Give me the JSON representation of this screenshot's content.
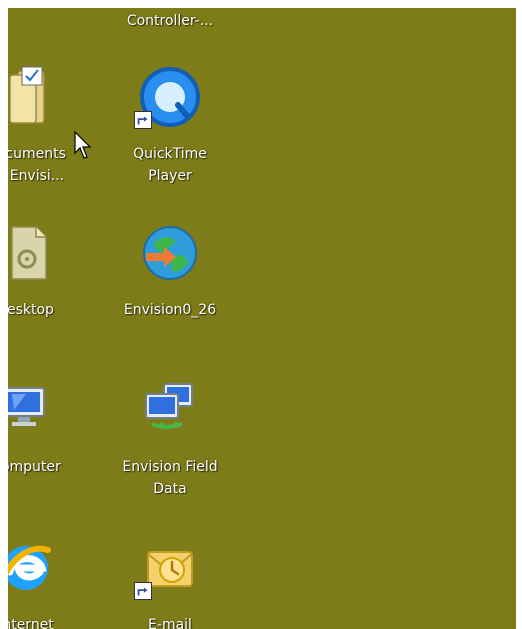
{
  "desktop": {
    "background_color": "#7e7c18",
    "icons": [
      {
        "label": "Controller-...",
        "icon": "controller-icon"
      },
      {
        "label_line1": "Documents",
        "label_line2": "on Envisi...",
        "icon": "folder-documents-icon"
      },
      {
        "label_line1": "QuickTime",
        "label_line2": "Player",
        "icon": "quicktime-icon"
      },
      {
        "label": "desktop",
        "icon": "desktop-file-icon"
      },
      {
        "label": "Envision0_26",
        "icon": "globe-icon"
      },
      {
        "label": "Computer",
        "icon": "computer-icon"
      },
      {
        "label_line1": "Envision Field",
        "label_line2": "Data",
        "icon": "network-icon"
      },
      {
        "label": "Internet",
        "icon": "internet-explorer-icon"
      },
      {
        "label": "E-mail",
        "icon": "email-icon"
      }
    ]
  }
}
